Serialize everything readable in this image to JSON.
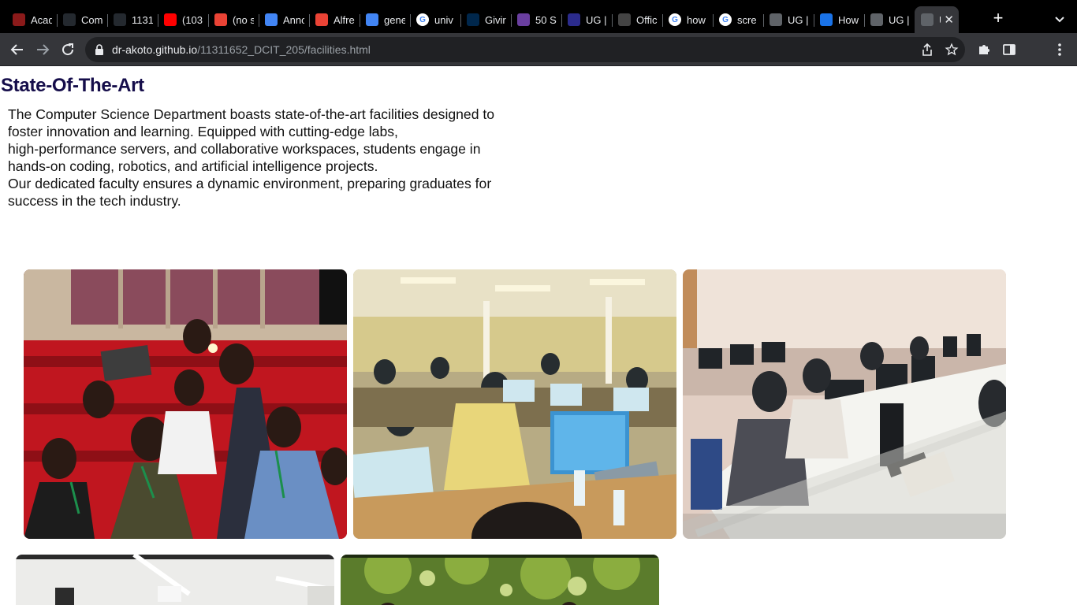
{
  "browser": {
    "tabs": [
      {
        "title": "Acad",
        "favicon": "academia-icon",
        "color": "#8b1a1a"
      },
      {
        "title": "Com",
        "favicon": "github-icon",
        "color": "#24292f"
      },
      {
        "title": "1131",
        "favicon": "github-icon",
        "color": "#24292f"
      },
      {
        "title": "(103",
        "favicon": "youtube-icon",
        "color": "#ff0000"
      },
      {
        "title": "(no s",
        "favicon": "gmail-icon",
        "color": "#ea4335"
      },
      {
        "title": "Anno",
        "favicon": "document-icon",
        "color": "#4285f4"
      },
      {
        "title": "Alfre",
        "favicon": "gmail-icon",
        "color": "#ea4335"
      },
      {
        "title": "gene",
        "favicon": "search-icon",
        "color": "#4285f4"
      },
      {
        "title": "univ",
        "favicon": "google-icon",
        "color": "#ffffff"
      },
      {
        "title": "Givir",
        "favicon": "michigan-icon",
        "color": "#00274c"
      },
      {
        "title": "50 S",
        "favicon": "bookmark-icon",
        "color": "#6a3fa0"
      },
      {
        "title": "UG |",
        "favicon": "ug-icon",
        "color": "#2b2b8c"
      },
      {
        "title": "Offic",
        "favicon": "office-icon",
        "color": "#444444"
      },
      {
        "title": "how",
        "favicon": "google-icon",
        "color": "#ffffff"
      },
      {
        "title": "scre",
        "favicon": "google-icon",
        "color": "#ffffff"
      },
      {
        "title": "UG |",
        "favicon": "globe-icon",
        "color": "#5f6368"
      },
      {
        "title": "How",
        "favicon": "site-icon",
        "color": "#1a73e8"
      },
      {
        "title": "UG |",
        "favicon": "globe-icon",
        "color": "#5f6368"
      },
      {
        "title": "U",
        "favicon": "globe-icon",
        "color": "#5f6368"
      }
    ],
    "new_tab_symbol": "+",
    "url_host": "dr-akoto.github.io",
    "url_path": "/11311652_DCIT_205/facilities.html"
  },
  "page": {
    "heading": "State-Of-The-Art",
    "description_lines": [
      "The Computer Science Department boasts state-of-the-art facilities designed to",
      "foster innovation and learning. Equipped with cutting-edge labs,",
      "high-performance servers, and collaborative workspaces, students engage in",
      "hands-on coding, robotics, and artificial intelligence projects.",
      "Our dedicated faculty ensures a dynamic environment, preparing graduates for",
      "success in the tech industry."
    ],
    "photos": [
      {
        "name": "auditorium-photo",
        "scene": "students seated in red auditorium chairs"
      },
      {
        "name": "computer-lab-photo-1",
        "scene": "large computer lab with students at monitors"
      },
      {
        "name": "computer-lab-photo-2",
        "scene": "students at rows of desktop computers"
      },
      {
        "name": "lab-room-photo",
        "scene": "room with ceiling lights"
      },
      {
        "name": "outdoor-photo",
        "scene": "students outdoors under trees"
      }
    ]
  }
}
